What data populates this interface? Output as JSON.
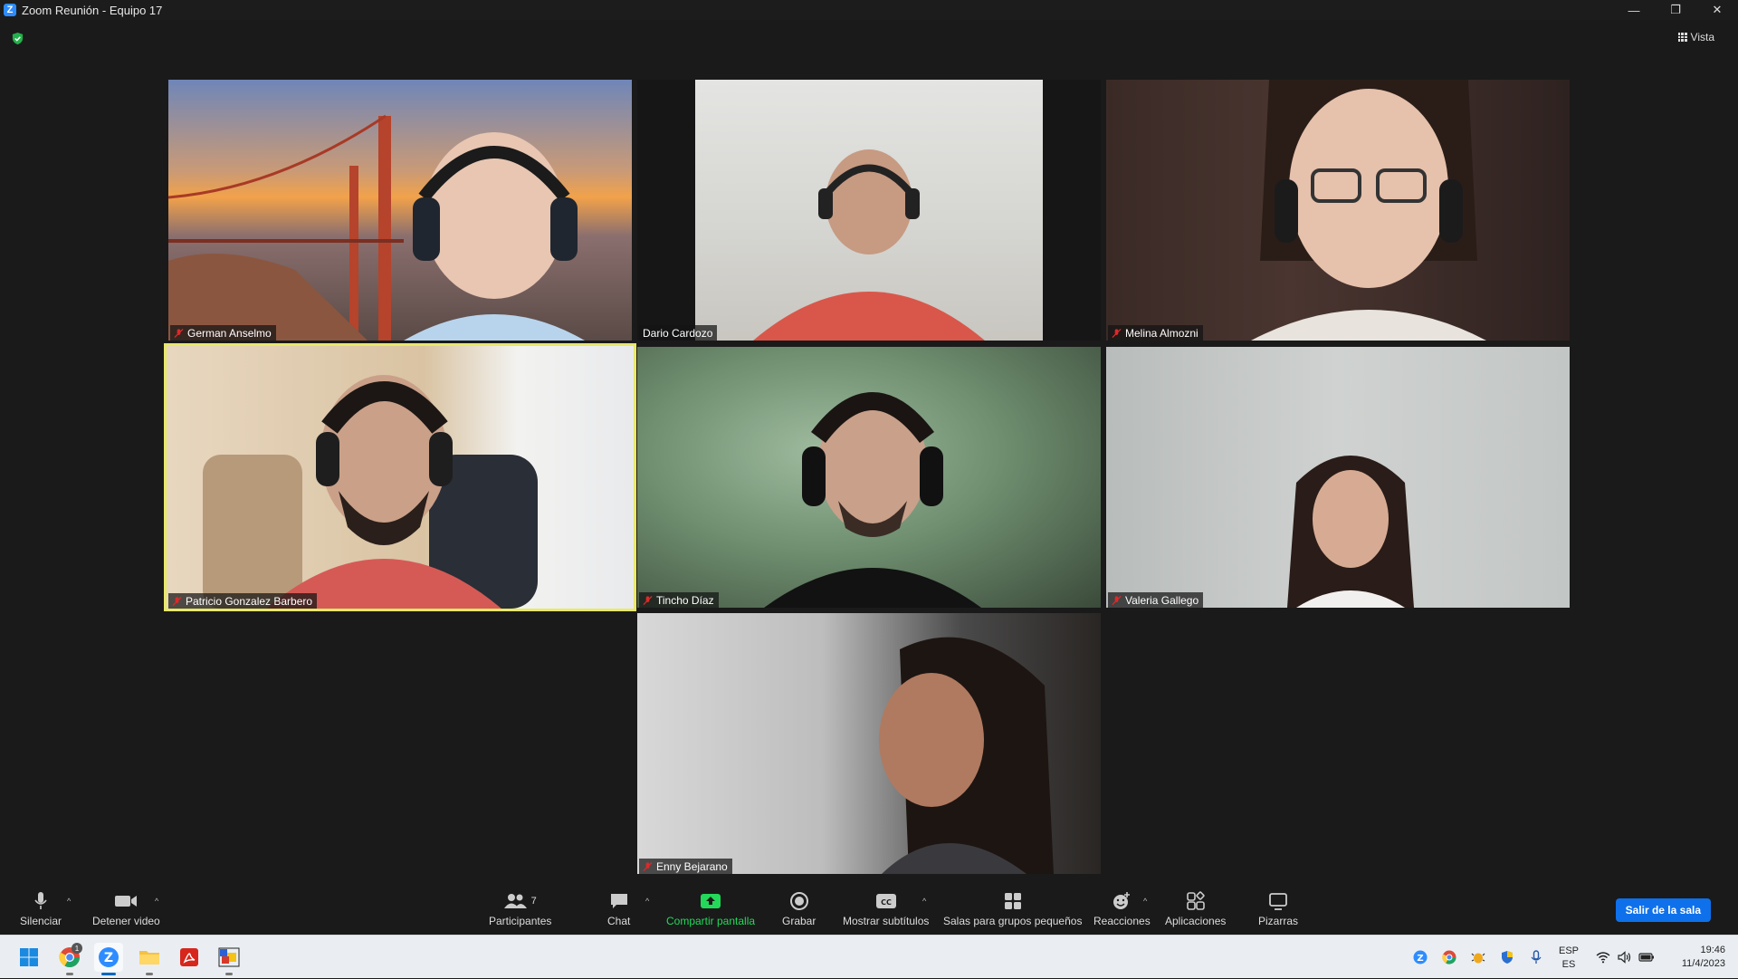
{
  "window": {
    "title": "Zoom Reunión - Equipo 17",
    "minimize": "—",
    "restore": "❐",
    "close": "✕"
  },
  "top": {
    "view_label": "Vista"
  },
  "participants": [
    {
      "name": "German Anselmo",
      "muted": true,
      "speaker": false
    },
    {
      "name": "Dario Cardozo",
      "muted": false,
      "speaker": false
    },
    {
      "name": "Melina Almozni",
      "muted": true,
      "speaker": false
    },
    {
      "name": "Patricio Gonzalez Barbero",
      "muted": true,
      "speaker": true
    },
    {
      "name": "Tincho Díaz",
      "muted": true,
      "speaker": false
    },
    {
      "name": "Valeria Gallego",
      "muted": true,
      "speaker": false
    },
    {
      "name": "Enny Bejarano",
      "muted": true,
      "speaker": false
    }
  ],
  "toolbar": {
    "mute": "Silenciar",
    "stop_video": "Detener video",
    "participants": "Participantes",
    "participants_count": "7",
    "chat": "Chat",
    "share": "Compartir pantalla",
    "record": "Grabar",
    "captions": "Mostrar subtítulos",
    "breakout": "Salas para grupos pequeños",
    "reactions": "Reacciones",
    "apps": "Aplicaciones",
    "whiteboards": "Pizarras",
    "leave": "Salir de la sala",
    "caret": "^",
    "share_color": "#23d959",
    "leave_color": "#0e71eb"
  },
  "taskbar": {
    "lang_top": "ESP",
    "lang_bottom": "ES",
    "time": "19:46",
    "date": "11/4/2023",
    "badge": "1"
  }
}
